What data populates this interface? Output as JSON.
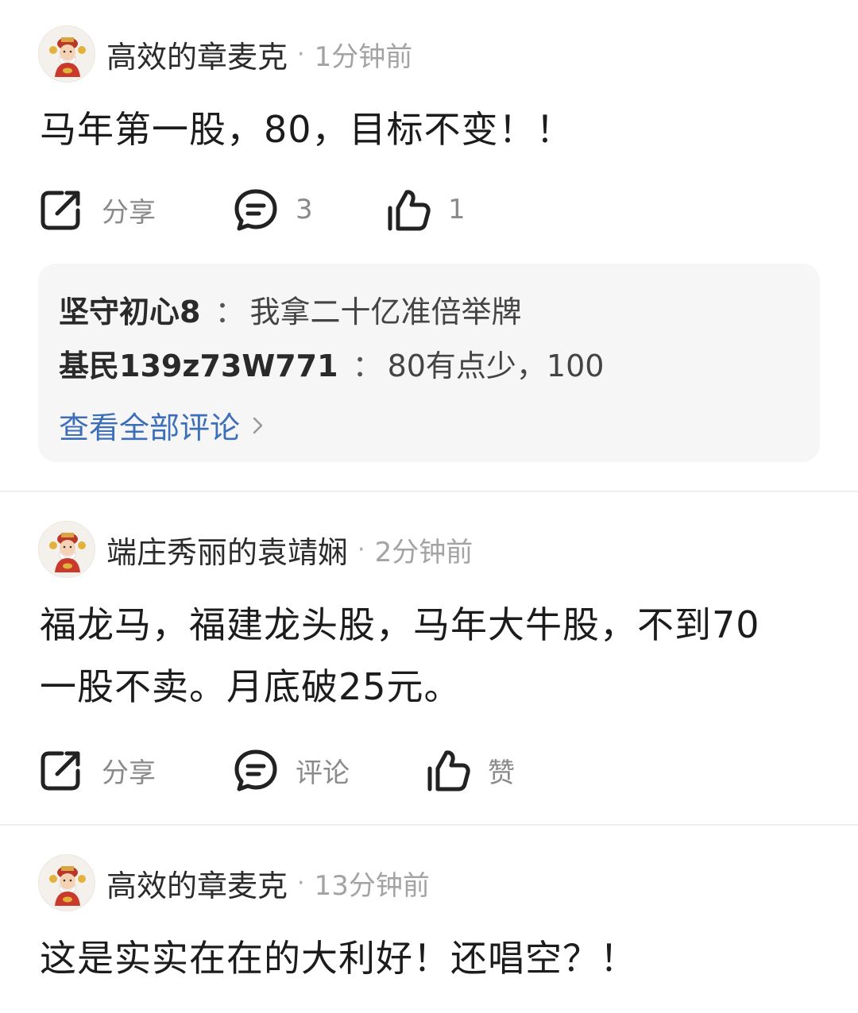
{
  "posts": [
    {
      "username": "高效的章麦克",
      "separator": "·",
      "time": "1分钟前",
      "content": "马年第一股，80，目标不变！！",
      "share_label": "分享",
      "comment_label": "3",
      "like_label": "1",
      "comments": [
        {
          "user": "坚守初心8",
          "sep": "：",
          "text": "我拿二十亿准倍举牌"
        },
        {
          "user": "基民139z73W771",
          "sep": "：",
          "text": "80有点少，100"
        }
      ],
      "view_all_label": "查看全部评论"
    },
    {
      "username": "端庄秀丽的袁靖娴",
      "separator": "·",
      "time": "2分钟前",
      "content_line1": "福龙马，福建龙头股，马年大牛股，不到70",
      "content_line2": "一股不卖。月底破25元。",
      "share_label": "分享",
      "comment_label": "评论",
      "like_label": "赞"
    },
    {
      "username": "高效的章麦克",
      "separator": "·",
      "time": "13分钟前",
      "content": "这是实实在在的大利好！还唱空？！"
    }
  ],
  "colors": {
    "link": "#3d6fb8",
    "muted": "#8a8a8a",
    "comment_bg": "#f6f6f6"
  },
  "icons": {
    "share": "share-icon",
    "comment": "comment-bubble-icon",
    "like": "thumbs-up-icon",
    "chevron": "chevron-right-icon",
    "avatar": "fortune-god-avatar"
  }
}
